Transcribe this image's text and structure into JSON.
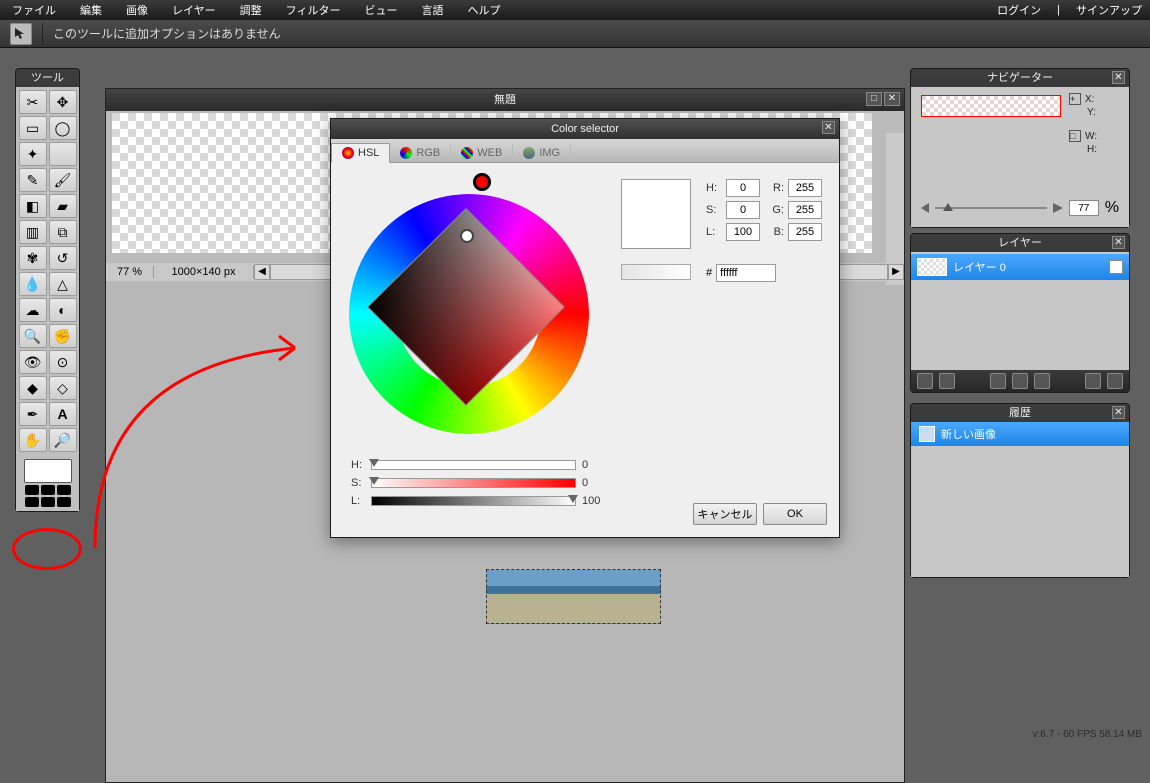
{
  "menu": {
    "items": [
      "ファイル",
      "編集",
      "画像",
      "レイヤー",
      "調整",
      "フィルター",
      "ビュー",
      "言語",
      "ヘルプ"
    ],
    "login": "ログイン",
    "signup": "サインアップ"
  },
  "optionbar": {
    "text": "このツールに追加オプションはありません"
  },
  "panels": {
    "tools": "ツール",
    "navigator": "ナビゲーター",
    "layers": "レイヤー",
    "history": "履歴"
  },
  "docwin": {
    "title": "無題",
    "zoom": "77",
    "zoomUnit": "%",
    "dimensions": "1000×140 px"
  },
  "color_selector": {
    "title": "Color selector",
    "tabs": {
      "hsl": "HSL",
      "rgb": "RGB",
      "web": "WEB",
      "img": "IMG"
    },
    "sliders": {
      "h_label": "H:",
      "s_label": "S:",
      "l_label": "L:",
      "h_val": "0",
      "s_val": "0",
      "l_val": "100"
    },
    "fields": {
      "h_label": "H:",
      "h": "0",
      "s_label": "S:",
      "s": "0",
      "l_label": "L:",
      "l": "100",
      "r_label": "R:",
      "r": "255",
      "g_label": "G:",
      "g": "255",
      "b_label": "B:",
      "b": "255",
      "hex_label": "#",
      "hex": "ffffff"
    },
    "buttons": {
      "cancel": "キャンセル",
      "ok": "OK"
    }
  },
  "navigator": {
    "x_label": "X:",
    "y_label": "Y:",
    "w_label": "W:",
    "h_label": "H:",
    "zoom": "77",
    "zoomUnit": "%"
  },
  "layers": {
    "layer0": "レイヤー 0"
  },
  "history": {
    "new_image": "新しい画像"
  },
  "status": "v:6.7 - 60 FPS 58.14 MB"
}
